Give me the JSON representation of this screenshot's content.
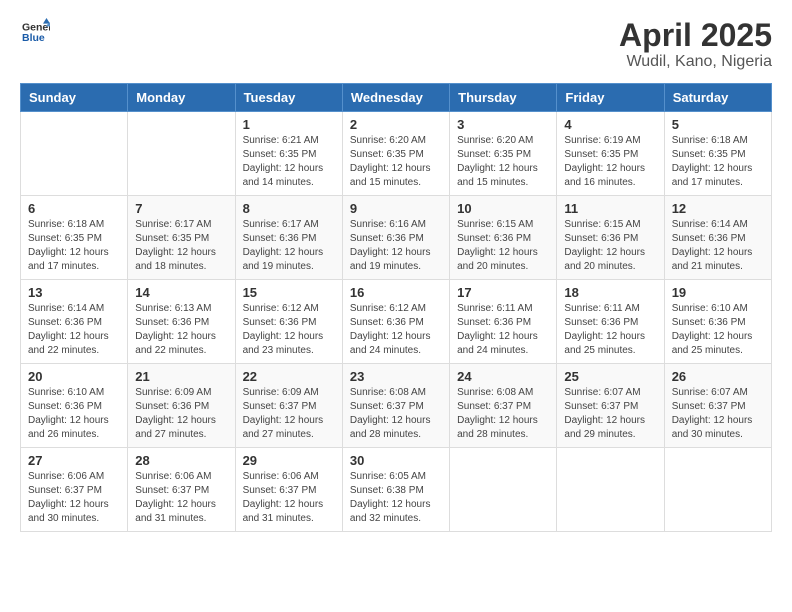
{
  "logo": {
    "line1": "General",
    "line2": "Blue"
  },
  "title": "April 2025",
  "subtitle": "Wudil, Kano, Nigeria",
  "days_header": [
    "Sunday",
    "Monday",
    "Tuesday",
    "Wednesday",
    "Thursday",
    "Friday",
    "Saturday"
  ],
  "weeks": [
    [
      {
        "day": "",
        "info": ""
      },
      {
        "day": "",
        "info": ""
      },
      {
        "day": "1",
        "info": "Sunrise: 6:21 AM\nSunset: 6:35 PM\nDaylight: 12 hours and 14 minutes."
      },
      {
        "day": "2",
        "info": "Sunrise: 6:20 AM\nSunset: 6:35 PM\nDaylight: 12 hours and 15 minutes."
      },
      {
        "day": "3",
        "info": "Sunrise: 6:20 AM\nSunset: 6:35 PM\nDaylight: 12 hours and 15 minutes."
      },
      {
        "day": "4",
        "info": "Sunrise: 6:19 AM\nSunset: 6:35 PM\nDaylight: 12 hours and 16 minutes."
      },
      {
        "day": "5",
        "info": "Sunrise: 6:18 AM\nSunset: 6:35 PM\nDaylight: 12 hours and 17 minutes."
      }
    ],
    [
      {
        "day": "6",
        "info": "Sunrise: 6:18 AM\nSunset: 6:35 PM\nDaylight: 12 hours and 17 minutes."
      },
      {
        "day": "7",
        "info": "Sunrise: 6:17 AM\nSunset: 6:35 PM\nDaylight: 12 hours and 18 minutes."
      },
      {
        "day": "8",
        "info": "Sunrise: 6:17 AM\nSunset: 6:36 PM\nDaylight: 12 hours and 19 minutes."
      },
      {
        "day": "9",
        "info": "Sunrise: 6:16 AM\nSunset: 6:36 PM\nDaylight: 12 hours and 19 minutes."
      },
      {
        "day": "10",
        "info": "Sunrise: 6:15 AM\nSunset: 6:36 PM\nDaylight: 12 hours and 20 minutes."
      },
      {
        "day": "11",
        "info": "Sunrise: 6:15 AM\nSunset: 6:36 PM\nDaylight: 12 hours and 20 minutes."
      },
      {
        "day": "12",
        "info": "Sunrise: 6:14 AM\nSunset: 6:36 PM\nDaylight: 12 hours and 21 minutes."
      }
    ],
    [
      {
        "day": "13",
        "info": "Sunrise: 6:14 AM\nSunset: 6:36 PM\nDaylight: 12 hours and 22 minutes."
      },
      {
        "day": "14",
        "info": "Sunrise: 6:13 AM\nSunset: 6:36 PM\nDaylight: 12 hours and 22 minutes."
      },
      {
        "day": "15",
        "info": "Sunrise: 6:12 AM\nSunset: 6:36 PM\nDaylight: 12 hours and 23 minutes."
      },
      {
        "day": "16",
        "info": "Sunrise: 6:12 AM\nSunset: 6:36 PM\nDaylight: 12 hours and 24 minutes."
      },
      {
        "day": "17",
        "info": "Sunrise: 6:11 AM\nSunset: 6:36 PM\nDaylight: 12 hours and 24 minutes."
      },
      {
        "day": "18",
        "info": "Sunrise: 6:11 AM\nSunset: 6:36 PM\nDaylight: 12 hours and 25 minutes."
      },
      {
        "day": "19",
        "info": "Sunrise: 6:10 AM\nSunset: 6:36 PM\nDaylight: 12 hours and 25 minutes."
      }
    ],
    [
      {
        "day": "20",
        "info": "Sunrise: 6:10 AM\nSunset: 6:36 PM\nDaylight: 12 hours and 26 minutes."
      },
      {
        "day": "21",
        "info": "Sunrise: 6:09 AM\nSunset: 6:36 PM\nDaylight: 12 hours and 27 minutes."
      },
      {
        "day": "22",
        "info": "Sunrise: 6:09 AM\nSunset: 6:37 PM\nDaylight: 12 hours and 27 minutes."
      },
      {
        "day": "23",
        "info": "Sunrise: 6:08 AM\nSunset: 6:37 PM\nDaylight: 12 hours and 28 minutes."
      },
      {
        "day": "24",
        "info": "Sunrise: 6:08 AM\nSunset: 6:37 PM\nDaylight: 12 hours and 28 minutes."
      },
      {
        "day": "25",
        "info": "Sunrise: 6:07 AM\nSunset: 6:37 PM\nDaylight: 12 hours and 29 minutes."
      },
      {
        "day": "26",
        "info": "Sunrise: 6:07 AM\nSunset: 6:37 PM\nDaylight: 12 hours and 30 minutes."
      }
    ],
    [
      {
        "day": "27",
        "info": "Sunrise: 6:06 AM\nSunset: 6:37 PM\nDaylight: 12 hours and 30 minutes."
      },
      {
        "day": "28",
        "info": "Sunrise: 6:06 AM\nSunset: 6:37 PM\nDaylight: 12 hours and 31 minutes."
      },
      {
        "day": "29",
        "info": "Sunrise: 6:06 AM\nSunset: 6:37 PM\nDaylight: 12 hours and 31 minutes."
      },
      {
        "day": "30",
        "info": "Sunrise: 6:05 AM\nSunset: 6:38 PM\nDaylight: 12 hours and 32 minutes."
      },
      {
        "day": "",
        "info": ""
      },
      {
        "day": "",
        "info": ""
      },
      {
        "day": "",
        "info": ""
      }
    ]
  ]
}
